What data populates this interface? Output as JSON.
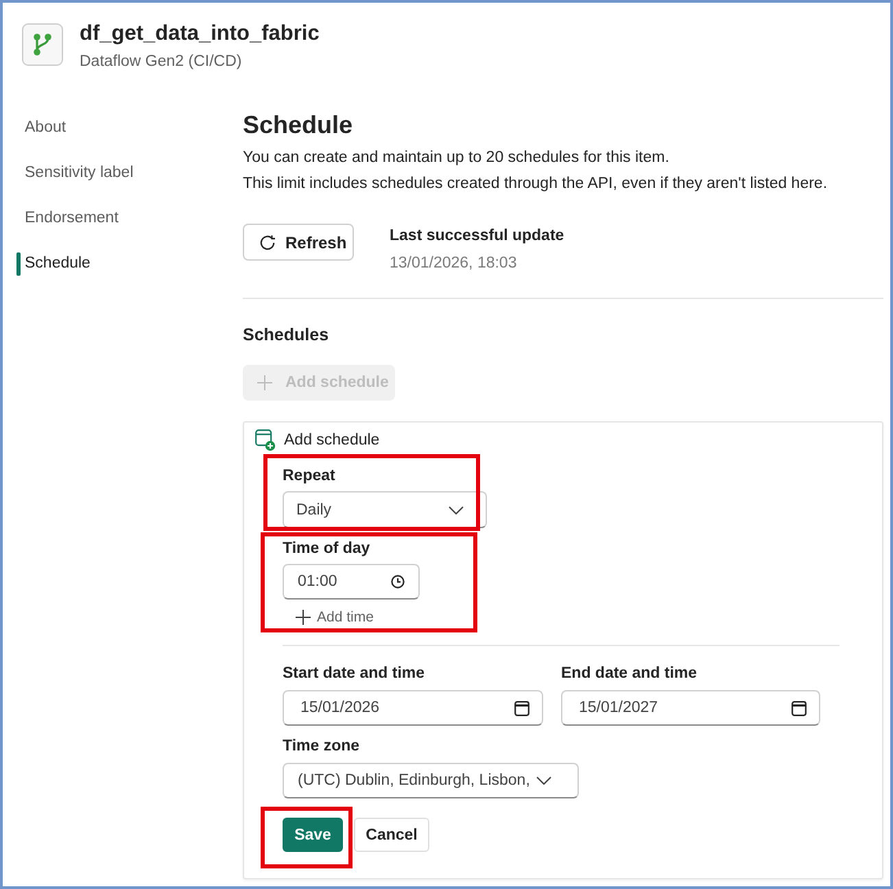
{
  "header": {
    "title": "df_get_data_into_fabric",
    "subtitle": "Dataflow Gen2 (CI/CD)"
  },
  "sidebar": {
    "items": [
      {
        "label": "About",
        "selected": false
      },
      {
        "label": "Sensitivity label",
        "selected": false
      },
      {
        "label": "Endorsement",
        "selected": false
      },
      {
        "label": "Schedule",
        "selected": true
      }
    ]
  },
  "page": {
    "heading": "Schedule",
    "description": [
      "You can create and maintain up to 20 schedules for this item.",
      "This limit includes schedules created through the API, even if they aren't listed here."
    ],
    "refresh_button": "Refresh",
    "last_update": {
      "label": "Last successful update",
      "value": "13/01/2026, 18:03"
    }
  },
  "schedules": {
    "heading": "Schedules",
    "add_button": {
      "label": "Add schedule",
      "disabled": true
    },
    "form": {
      "title": "Add schedule",
      "repeat": {
        "label": "Repeat",
        "value": "Daily",
        "highlighted": true
      },
      "time_of_day": {
        "label": "Time of day",
        "times": [
          "01:00"
        ],
        "add_link": "Add time",
        "highlighted": true
      },
      "start": {
        "label": "Start date and time",
        "value": "15/01/2026"
      },
      "end": {
        "label": "End date and time",
        "value": "15/01/2027"
      },
      "time_zone": {
        "label": "Time zone",
        "value": "(UTC) Dublin, Edinburgh, Lisbon,"
      },
      "buttons": [
        {
          "label": "Save",
          "kind": "primary",
          "highlighted": true
        },
        {
          "label": "Cancel",
          "kind": "secondary",
          "highlighted": false
        }
      ]
    }
  }
}
